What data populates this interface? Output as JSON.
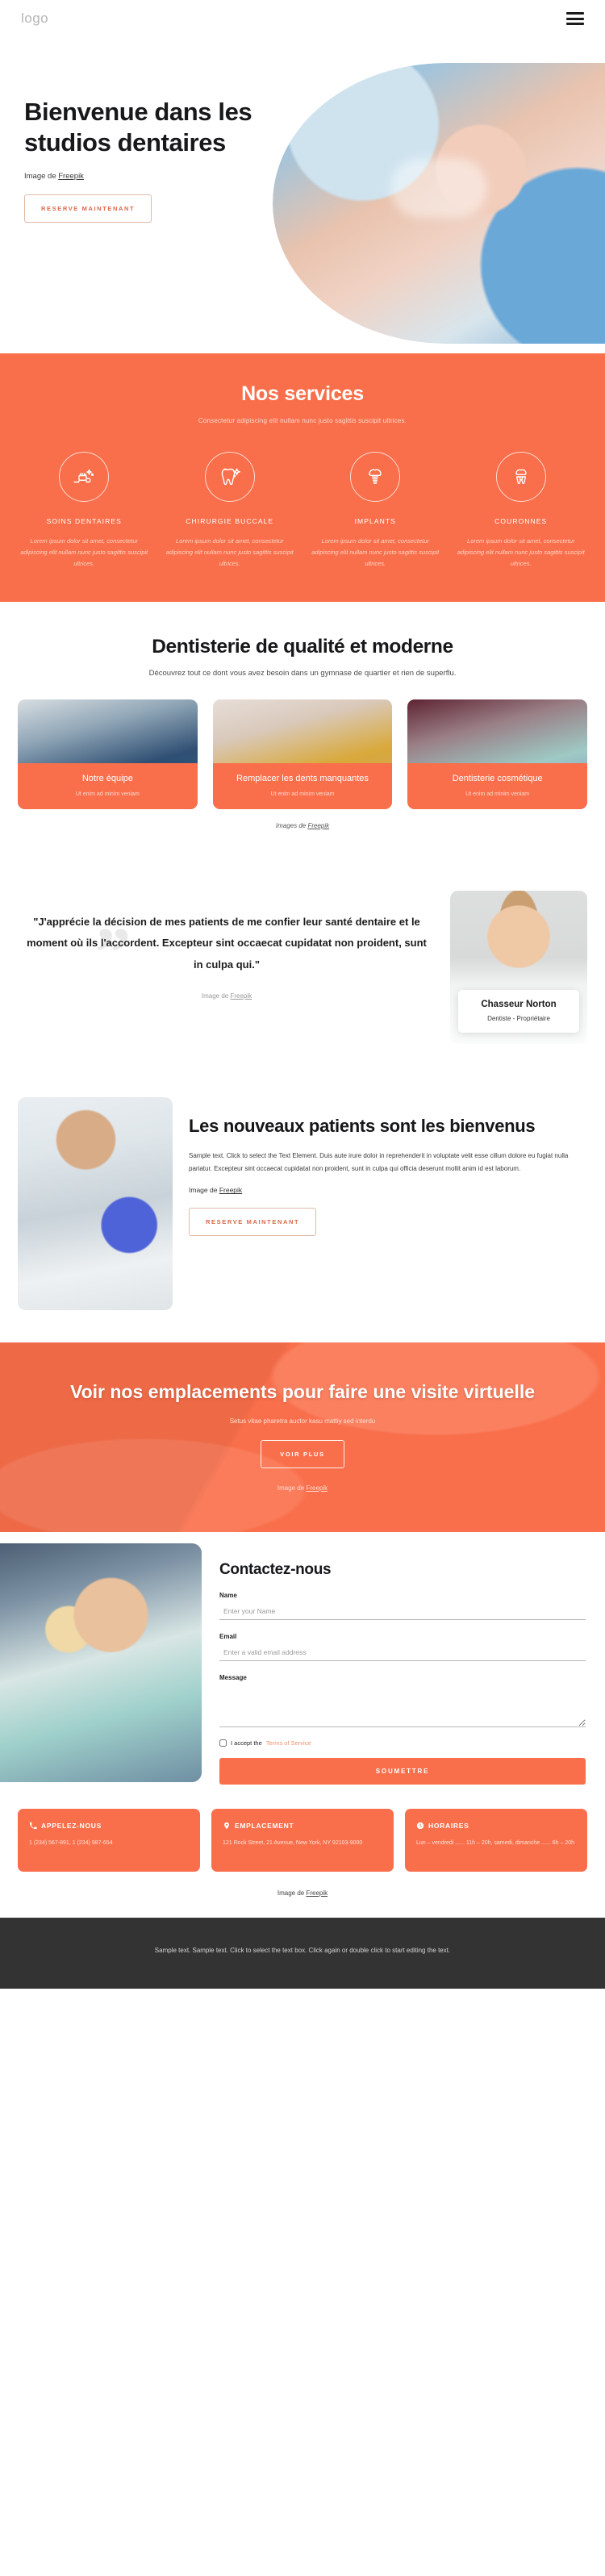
{
  "header": {
    "logo": "logo",
    "menu_icon": "hamburger-icon"
  },
  "hero": {
    "title": "Bienvenue dans les studios dentaires",
    "attribution_prefix": "Image de ",
    "attribution_link": "Freepik",
    "cta": "RESERVE MAINTENANT"
  },
  "services": {
    "title": "Nos services",
    "subtitle": "Consectetur adipiscing elit nullam nunc justo sagittis suscipit ultrices.",
    "items": [
      {
        "icon": "toothbrush-icon",
        "name": "SOINS DENTAIRES",
        "desc": "Lorem ipsum dolor sit amet, consectetur adipiscing elit nullam nunc justo sagittis suscipit ultrices."
      },
      {
        "icon": "sparkling-tooth-icon",
        "name": "CHIRURGIE BUCCALE",
        "desc": "Lorem ipsum dolor sit amet, consectetur adipiscing elit nullam nunc justo sagittis suscipit ultrices."
      },
      {
        "icon": "dental-implant-icon",
        "name": "IMPLANTS",
        "desc": "Lorem ipsum dolor sit amet, consectetur adipiscing elit nullam nunc justo sagittis suscipit ultrices."
      },
      {
        "icon": "dental-crown-icon",
        "name": "COURONNES",
        "desc": "Lorem ipsum dolor sit amet, consectetur adipiscing elit nullam nunc justo sagittis suscipit ultrices."
      }
    ]
  },
  "quality": {
    "title": "Dentisterie de qualité et moderne",
    "subtitle": "Découvrez tout ce dont vous avez besoin dans un gymnase de quartier et rien de superflu.",
    "cards": [
      {
        "title": "Notre équipe",
        "subtitle": "Ut enim ad minim veniam"
      },
      {
        "title": "Remplacer les dents manquantes",
        "subtitle": "Ut enim ad minim veniam"
      },
      {
        "title": "Dentisterie cosmétique",
        "subtitle": "Ut enim ad minim veniam"
      }
    ],
    "attribution_prefix": "Images de ",
    "attribution_link": "Freepik"
  },
  "testimonial": {
    "quote": "\"J'apprécie la décision de mes patients de me confier leur santé dentaire et le moment où ils l'accordent. Excepteur sint occaecat cupidatat non proident, sunt in culpa qui.\"",
    "attribution_prefix": "Image de ",
    "attribution_link": "Freepik",
    "doctor_name": "Chasseur Norton",
    "doctor_role": "Dentiste - Propriétaire"
  },
  "new_patients": {
    "title": "Les nouveaux patients sont les bienvenus",
    "body": "Sample text. Click to select the Text Element. Duis aute irure dolor in reprehenderit in voluptate velit esse cillum dolore eu fugiat nulla pariatur. Excepteur sint occaecat cupidatat non proident, sunt in culpa qui officia deserunt mollit anim id est laborum.",
    "attribution_prefix": "Image de ",
    "attribution_link": "Freepik",
    "cta": "RESERVE MAINTENANT"
  },
  "locations": {
    "title": "Voir nos emplacements pour faire une visite virtuelle",
    "subtitle": "Setus vitae pharetra auctor kasu mattiy sed interdu",
    "cta": "VOIR PLUS",
    "attribution_prefix": "Image de ",
    "attribution_link": "Freepik"
  },
  "contact": {
    "title": "Contactez-nous",
    "name_label": "Name",
    "name_placeholder": "Enter your Name",
    "email_label": "Email",
    "email_placeholder": "Enter a valid email address",
    "message_label": "Message",
    "message_placeholder": "",
    "terms_text": "I accept the ",
    "terms_link": "Terms of Service",
    "submit": "SOUMETTRE"
  },
  "info_cards": [
    {
      "icon": "phone-icon",
      "title": "APPELEZ-NOUS",
      "body": "1 (234) 567-891, 1 (234) 987-654"
    },
    {
      "icon": "map-pin-icon",
      "title": "EMPLACEMENT",
      "body": "121 Rock Street, 21 Avenue, New York, NY 92103-9000"
    },
    {
      "icon": "clock-icon",
      "title": "HORAIRES",
      "body": "Lun – vendredi ...... 11h – 20h, samedi, dimanche  ...... 6h – 20h"
    }
  ],
  "bottom_attribution": {
    "prefix": "Image de ",
    "link": "Freepik"
  },
  "footer": {
    "text": "Sample text. Sample text. Click to select the text box. Click again or double click to start editing the text."
  },
  "colors": {
    "accent": "#f96f4b",
    "footer_bg": "#333333",
    "text_dark": "#17181a"
  }
}
